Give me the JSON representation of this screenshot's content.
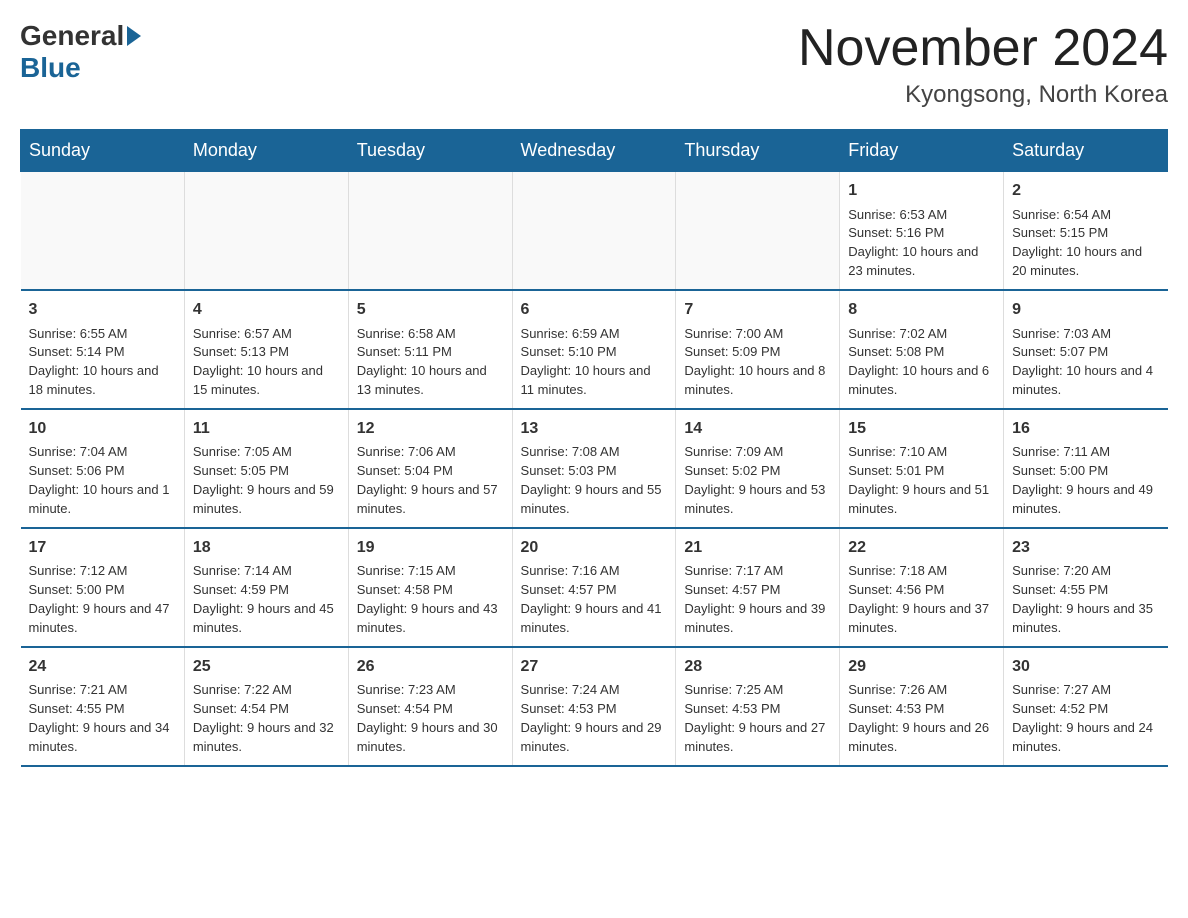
{
  "header": {
    "logo_general": "General",
    "logo_blue": "Blue",
    "month_title": "November 2024",
    "location": "Kyongsong, North Korea"
  },
  "weekdays": [
    "Sunday",
    "Monday",
    "Tuesday",
    "Wednesday",
    "Thursday",
    "Friday",
    "Saturday"
  ],
  "weeks": [
    [
      {
        "day": "",
        "info": ""
      },
      {
        "day": "",
        "info": ""
      },
      {
        "day": "",
        "info": ""
      },
      {
        "day": "",
        "info": ""
      },
      {
        "day": "",
        "info": ""
      },
      {
        "day": "1",
        "info": "Sunrise: 6:53 AM\nSunset: 5:16 PM\nDaylight: 10 hours and 23 minutes."
      },
      {
        "day": "2",
        "info": "Sunrise: 6:54 AM\nSunset: 5:15 PM\nDaylight: 10 hours and 20 minutes."
      }
    ],
    [
      {
        "day": "3",
        "info": "Sunrise: 6:55 AM\nSunset: 5:14 PM\nDaylight: 10 hours and 18 minutes."
      },
      {
        "day": "4",
        "info": "Sunrise: 6:57 AM\nSunset: 5:13 PM\nDaylight: 10 hours and 15 minutes."
      },
      {
        "day": "5",
        "info": "Sunrise: 6:58 AM\nSunset: 5:11 PM\nDaylight: 10 hours and 13 minutes."
      },
      {
        "day": "6",
        "info": "Sunrise: 6:59 AM\nSunset: 5:10 PM\nDaylight: 10 hours and 11 minutes."
      },
      {
        "day": "7",
        "info": "Sunrise: 7:00 AM\nSunset: 5:09 PM\nDaylight: 10 hours and 8 minutes."
      },
      {
        "day": "8",
        "info": "Sunrise: 7:02 AM\nSunset: 5:08 PM\nDaylight: 10 hours and 6 minutes."
      },
      {
        "day": "9",
        "info": "Sunrise: 7:03 AM\nSunset: 5:07 PM\nDaylight: 10 hours and 4 minutes."
      }
    ],
    [
      {
        "day": "10",
        "info": "Sunrise: 7:04 AM\nSunset: 5:06 PM\nDaylight: 10 hours and 1 minute."
      },
      {
        "day": "11",
        "info": "Sunrise: 7:05 AM\nSunset: 5:05 PM\nDaylight: 9 hours and 59 minutes."
      },
      {
        "day": "12",
        "info": "Sunrise: 7:06 AM\nSunset: 5:04 PM\nDaylight: 9 hours and 57 minutes."
      },
      {
        "day": "13",
        "info": "Sunrise: 7:08 AM\nSunset: 5:03 PM\nDaylight: 9 hours and 55 minutes."
      },
      {
        "day": "14",
        "info": "Sunrise: 7:09 AM\nSunset: 5:02 PM\nDaylight: 9 hours and 53 minutes."
      },
      {
        "day": "15",
        "info": "Sunrise: 7:10 AM\nSunset: 5:01 PM\nDaylight: 9 hours and 51 minutes."
      },
      {
        "day": "16",
        "info": "Sunrise: 7:11 AM\nSunset: 5:00 PM\nDaylight: 9 hours and 49 minutes."
      }
    ],
    [
      {
        "day": "17",
        "info": "Sunrise: 7:12 AM\nSunset: 5:00 PM\nDaylight: 9 hours and 47 minutes."
      },
      {
        "day": "18",
        "info": "Sunrise: 7:14 AM\nSunset: 4:59 PM\nDaylight: 9 hours and 45 minutes."
      },
      {
        "day": "19",
        "info": "Sunrise: 7:15 AM\nSunset: 4:58 PM\nDaylight: 9 hours and 43 minutes."
      },
      {
        "day": "20",
        "info": "Sunrise: 7:16 AM\nSunset: 4:57 PM\nDaylight: 9 hours and 41 minutes."
      },
      {
        "day": "21",
        "info": "Sunrise: 7:17 AM\nSunset: 4:57 PM\nDaylight: 9 hours and 39 minutes."
      },
      {
        "day": "22",
        "info": "Sunrise: 7:18 AM\nSunset: 4:56 PM\nDaylight: 9 hours and 37 minutes."
      },
      {
        "day": "23",
        "info": "Sunrise: 7:20 AM\nSunset: 4:55 PM\nDaylight: 9 hours and 35 minutes."
      }
    ],
    [
      {
        "day": "24",
        "info": "Sunrise: 7:21 AM\nSunset: 4:55 PM\nDaylight: 9 hours and 34 minutes."
      },
      {
        "day": "25",
        "info": "Sunrise: 7:22 AM\nSunset: 4:54 PM\nDaylight: 9 hours and 32 minutes."
      },
      {
        "day": "26",
        "info": "Sunrise: 7:23 AM\nSunset: 4:54 PM\nDaylight: 9 hours and 30 minutes."
      },
      {
        "day": "27",
        "info": "Sunrise: 7:24 AM\nSunset: 4:53 PM\nDaylight: 9 hours and 29 minutes."
      },
      {
        "day": "28",
        "info": "Sunrise: 7:25 AM\nSunset: 4:53 PM\nDaylight: 9 hours and 27 minutes."
      },
      {
        "day": "29",
        "info": "Sunrise: 7:26 AM\nSunset: 4:53 PM\nDaylight: 9 hours and 26 minutes."
      },
      {
        "day": "30",
        "info": "Sunrise: 7:27 AM\nSunset: 4:52 PM\nDaylight: 9 hours and 24 minutes."
      }
    ]
  ]
}
